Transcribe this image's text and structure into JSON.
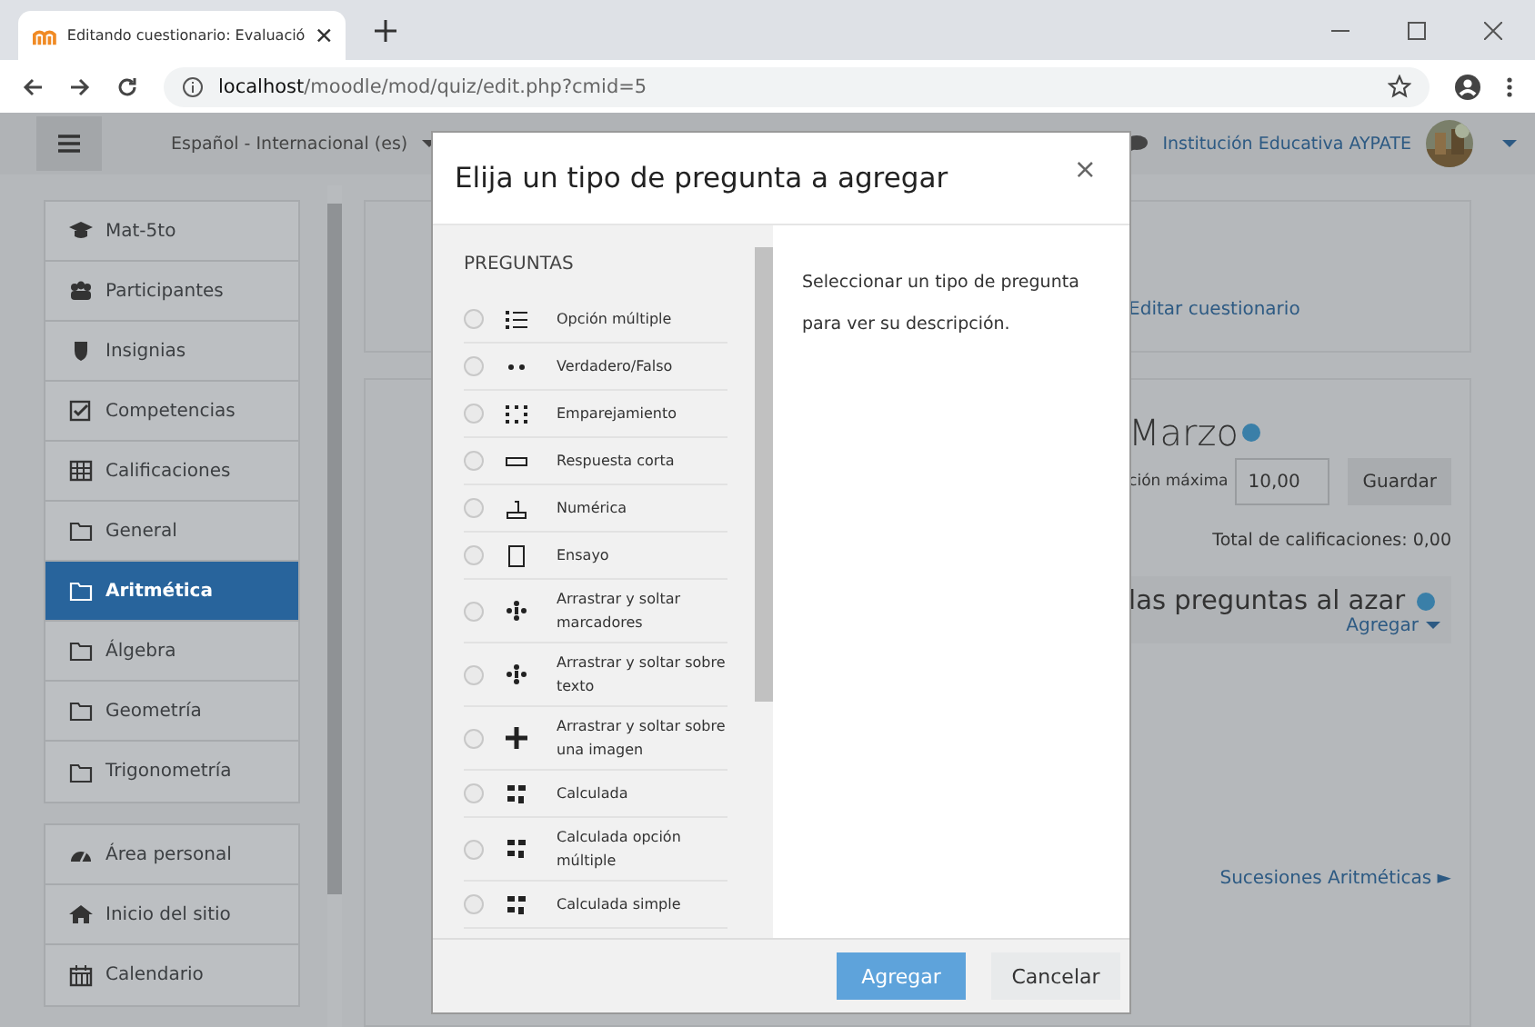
{
  "browser": {
    "tab_title": "Editando cuestionario: Evaluació",
    "url_host": "localhost",
    "url_path": "/moodle/mod/quiz/edit.php?cmid=5"
  },
  "navbar": {
    "language": "Español - Internacional (es)",
    "user": "Institución Educativa AYPATE"
  },
  "sidebar": {
    "sections": [
      {
        "items": [
          {
            "label": "Mat-5to",
            "selected": false
          },
          {
            "label": "Participantes",
            "selected": false
          },
          {
            "label": "Insignias",
            "selected": false
          },
          {
            "label": "Competencias",
            "selected": false
          },
          {
            "label": "Calificaciones",
            "selected": false
          },
          {
            "label": "General",
            "selected": false
          },
          {
            "label": "Aritmética",
            "selected": true
          },
          {
            "label": "Álgebra",
            "selected": false
          },
          {
            "label": "Geometría",
            "selected": false
          },
          {
            "label": "Trigonometría",
            "selected": false
          }
        ]
      },
      {
        "items": [
          {
            "label": "Área personal",
            "selected": false
          },
          {
            "label": "Inicio del sitio",
            "selected": false
          },
          {
            "label": "Calendario",
            "selected": false
          }
        ]
      }
    ]
  },
  "main": {
    "edit_link": "Editar cuestionario",
    "heading": "Marzo",
    "max_grade_label": "ción máxima",
    "max_grade_value": "10,00",
    "save_button": "Guardar",
    "total": "Total de calificaciones: 0,00",
    "shuffle_heading": "las preguntas al azar",
    "add_menu": "Agregar",
    "next_link": "Sucesiones Aritméticas ►"
  },
  "dialog": {
    "title": "Elija un tipo de pregunta a agregar",
    "close": "×",
    "section": "PREGUNTAS",
    "description": "Seleccionar un tipo de pregunta para ver su descripción.",
    "questions": [
      {
        "label": "Opción múltiple",
        "selected": false
      },
      {
        "label": "Verdadero/Falso",
        "selected": false
      },
      {
        "label": "Emparejamiento",
        "selected": false
      },
      {
        "label": "Respuesta corta",
        "selected": false
      },
      {
        "label": "Numérica",
        "selected": false
      },
      {
        "label": "Ensayo",
        "selected": false
      },
      {
        "label": "Arrastrar y soltar marcadores",
        "selected": false
      },
      {
        "label": "Arrastrar y soltar sobre texto",
        "selected": false
      },
      {
        "label": "Arrastrar y soltar sobre una imagen",
        "selected": false
      },
      {
        "label": "Calculada",
        "selected": false
      },
      {
        "label": "Calculada opción múltiple",
        "selected": false
      },
      {
        "label": "Calculada simple",
        "selected": false
      }
    ],
    "buttons": {
      "primary": "Agregar",
      "secondary": "Cancelar"
    }
  }
}
